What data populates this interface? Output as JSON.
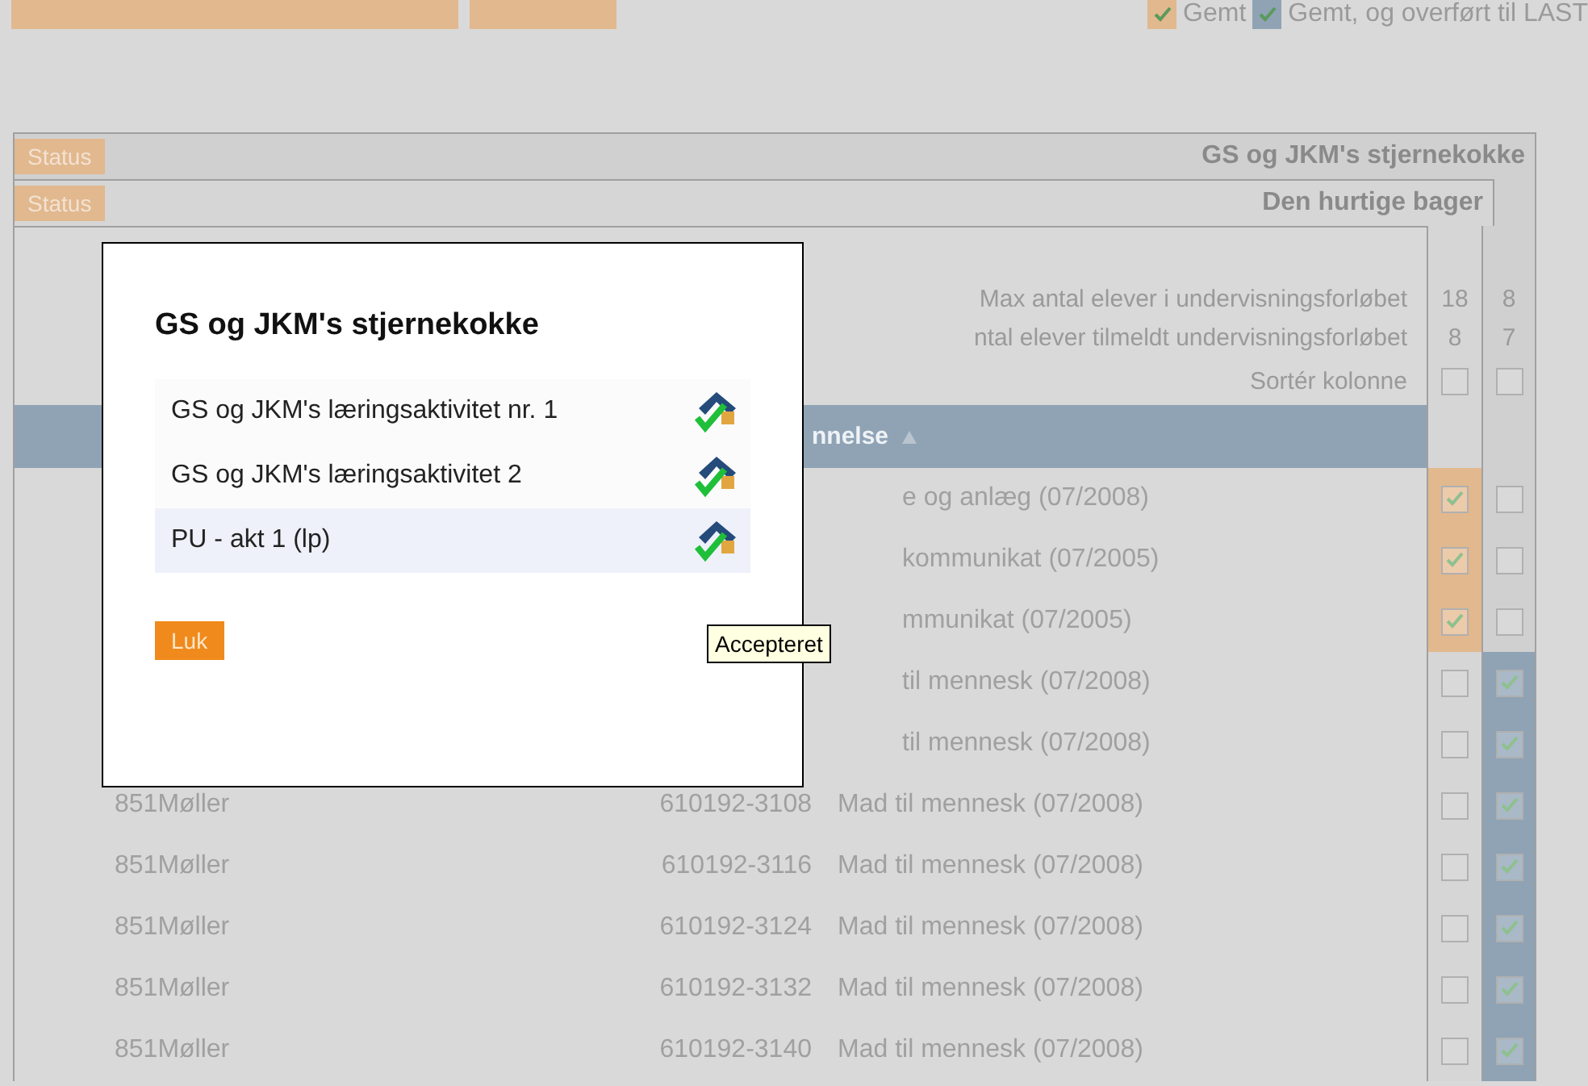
{
  "top_bar": {
    "legend": [
      {
        "label": "Gemt",
        "color": "#e2b88e"
      },
      {
        "label": "Gemt, og overført til LAST",
        "color": "#8fa3b5"
      }
    ]
  },
  "groups": [
    {
      "status": "Status",
      "title": "GS og JKM's stjernekokke"
    },
    {
      "status": "Status",
      "title": "Den hurtige bager"
    }
  ],
  "counts": [
    {
      "label": "Max antal elever i undervisningsforløbet",
      "values": [
        "18",
        "8"
      ]
    },
    {
      "label": "ntal elever tilmeldt undervisningsforløbet",
      "values": [
        "8",
        "7"
      ]
    }
  ],
  "sort": {
    "label": "Sortér kolonne",
    "checked": [
      false,
      false
    ]
  },
  "table_header": {
    "label": "nnelse"
  },
  "rows": [
    {
      "kind": "partial",
      "description": "e og anlæg (07/2008)",
      "checks": [
        true,
        false
      ]
    },
    {
      "kind": "partial",
      "description": "kommunikat (07/2005)",
      "checks": [
        true,
        false
      ]
    },
    {
      "kind": "partial",
      "description": "mmunikat (07/2005)",
      "checks": [
        true,
        false
      ]
    },
    {
      "kind": "partial",
      "description": "til mennesk (07/2008)",
      "checks": [
        false,
        true
      ]
    },
    {
      "kind": "partial",
      "description": "til mennesk (07/2008)",
      "checks": [
        false,
        true
      ]
    },
    {
      "kind": "full",
      "name": "851Møller",
      "number": "610192-3108",
      "description": "Mad til mennesk (07/2008)",
      "checks": [
        false,
        true
      ]
    },
    {
      "kind": "full",
      "name": "851Møller",
      "number": "610192-3116",
      "description": "Mad til mennesk (07/2008)",
      "checks": [
        false,
        true
      ]
    },
    {
      "kind": "full",
      "name": "851Møller",
      "number": "610192-3124",
      "description": "Mad til mennesk (07/2008)",
      "checks": [
        false,
        true
      ]
    },
    {
      "kind": "full",
      "name": "851Møller",
      "number": "610192-3132",
      "description": "Mad til mennesk (07/2008)",
      "checks": [
        false,
        true
      ]
    },
    {
      "kind": "full",
      "name": "851Møller",
      "number": "610192-3140",
      "description": "Mad til mennesk (07/2008)",
      "checks": [
        false,
        true
      ]
    }
  ],
  "dialog": {
    "title": "GS og JKM's stjernekokke",
    "items": [
      {
        "label": "GS og JKM's læringsaktivitet nr. 1",
        "highlighted": false
      },
      {
        "label": "GS og JKM's læringsaktivitet 2",
        "highlighted": false
      },
      {
        "label": "PU - akt 1 (lp)",
        "highlighted": true
      }
    ],
    "close_button": "Luk"
  },
  "tooltip": {
    "text": "Accepteret"
  }
}
